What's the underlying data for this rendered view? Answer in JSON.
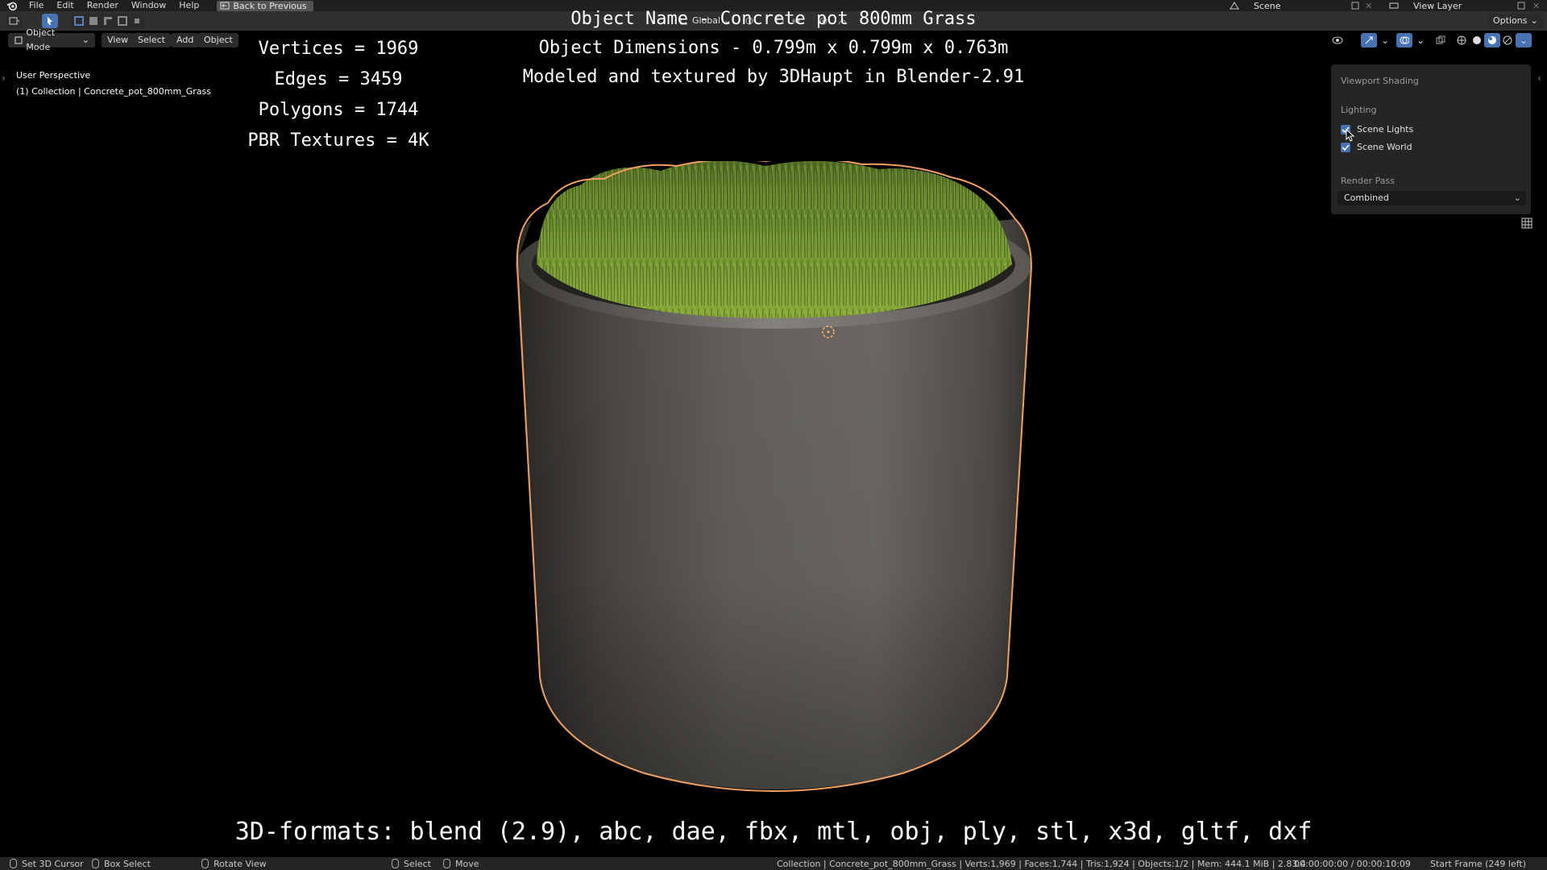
{
  "menu": {
    "items": [
      "File",
      "Edit",
      "Render",
      "Window",
      "Help"
    ],
    "back_button": "Back to Previous",
    "scene": "Scene",
    "view_layer": "View Layer"
  },
  "toolbar": {
    "transform_orientation": "Global",
    "options": "Options"
  },
  "viewport_header": {
    "mode": "Object Mode",
    "menus": [
      "View",
      "Select",
      "Add",
      "Object"
    ]
  },
  "viewport": {
    "perspective": "User Perspective",
    "collection": "(1) Collection | Concrete_pot_800mm_Grass"
  },
  "overlay": {
    "object_name": "Object Name - Concrete pot 800mm Grass",
    "dimensions": "Object Dimensions -  0.799m x 0.799m x 0.763m",
    "credits": "Modeled and textured by 3DHaupt in Blender-2.91",
    "vertices": "Vertices = 1969",
    "edges": "Edges = 3459",
    "polygons": "Polygons = 1744",
    "textures": "PBR Textures = 4K",
    "formats": "3D-formats: blend (2.9), abc, dae, fbx, mtl, obj, ply, stl, x3d, gltf, dxf"
  },
  "shading_panel": {
    "title": "Viewport Shading",
    "lighting_label": "Lighting",
    "scene_lights": "Scene Lights",
    "scene_lights_checked": true,
    "scene_world": "Scene World",
    "scene_world_checked": true,
    "render_pass_label": "Render Pass",
    "render_pass_value": "Combined"
  },
  "statusbar": {
    "set_cursor": "Set 3D Cursor",
    "box_select": "Box Select",
    "rotate_view": "Rotate View",
    "select": "Select",
    "move": "Move",
    "stats": "Collection | Concrete_pot_800mm_Grass | Verts:1,969 | Faces:1,744 | Tris:1,924 | Objects:1/2 | Mem: 444.1 MiB | 2.83.4",
    "time": "00:00:00:00 / 00:00:10:09",
    "frame": "Start Frame (249 left)"
  },
  "colors": {
    "accent": "#4772b3",
    "outline": "#f0a060",
    "grass": "#6b8f2e"
  }
}
